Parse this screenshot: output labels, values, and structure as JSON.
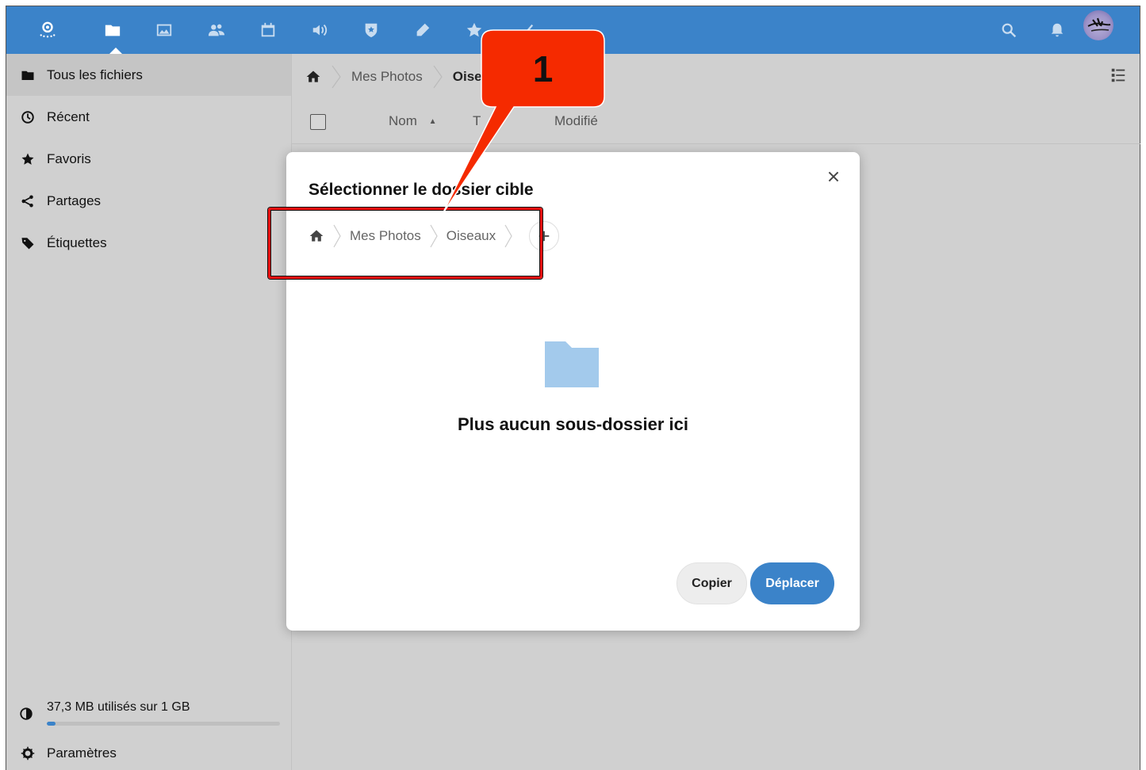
{
  "header": {
    "icons": [
      "app-logo-icon",
      "files-icon",
      "gallery-icon",
      "contacts-icon",
      "calendar-icon",
      "audio-icon",
      "shield-icon",
      "notes-icon",
      "bookmarks-icon",
      "tasks-icon",
      "search-icon",
      "bell-icon",
      "avatar"
    ]
  },
  "sidebar": {
    "items": [
      {
        "label": "Tous les fichiers",
        "icon": "folder-icon",
        "active": true
      },
      {
        "label": "Récent",
        "icon": "clock-icon"
      },
      {
        "label": "Favoris",
        "icon": "star-icon"
      },
      {
        "label": "Partages",
        "icon": "share-icon"
      },
      {
        "label": "Étiquettes",
        "icon": "tag-icon"
      }
    ],
    "quota": {
      "text": "37,3 MB utilisés sur 1 GB",
      "used_fraction": 0.037
    },
    "settings_label": "Paramètres"
  },
  "main": {
    "breadcrumb": [
      "Mes Photos",
      "Oise"
    ],
    "columns": {
      "name": "Nom",
      "size": "T",
      "modified": "Modifié"
    }
  },
  "dialog": {
    "title": "Sélectionner le dossier cible",
    "breadcrumb": [
      "Mes Photos",
      "Oiseaux"
    ],
    "empty_text": "Plus aucun sous-dossier ici",
    "copy_label": "Copier",
    "move_label": "Déplacer"
  },
  "annotation": {
    "number": "1",
    "color": "#f52a00"
  },
  "colors": {
    "accent": "#3b83c9",
    "folder": "#a3caec"
  }
}
